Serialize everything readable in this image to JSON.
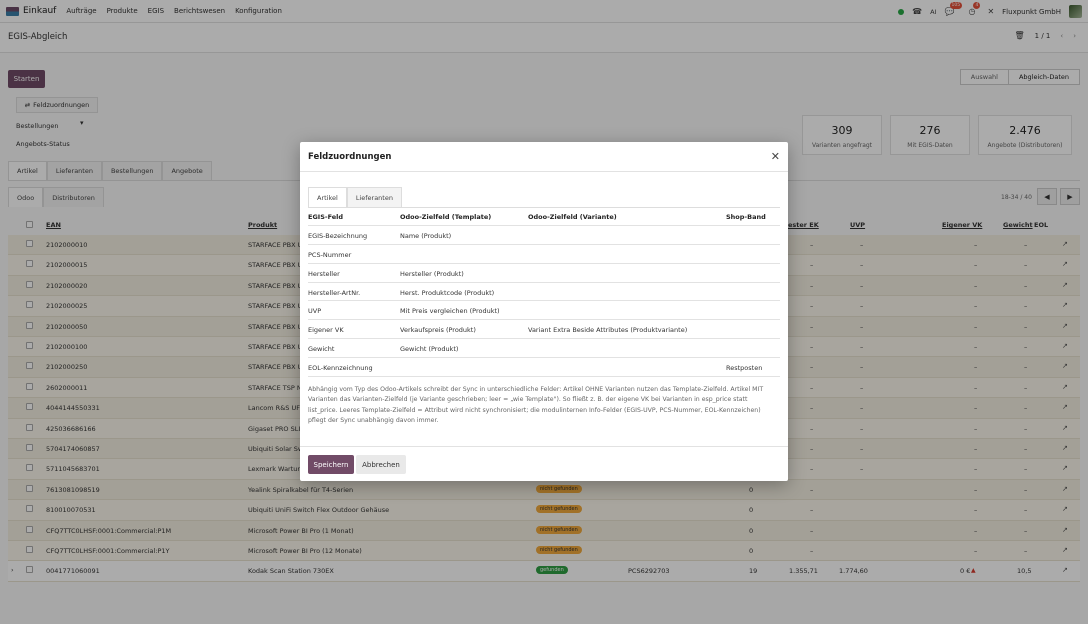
{
  "navbar": {
    "app_name": "Einkauf",
    "menu": [
      "Aufträge",
      "Produkte",
      "EGIS",
      "Berichtswesen",
      "Konfiguration"
    ],
    "badges": {
      "messages": "105",
      "activities": "4"
    },
    "company": "Fluxpunkt GmbH"
  },
  "control": {
    "title": "EGIS-Abgleich",
    "pager": "1 / 1"
  },
  "page": {
    "start_label": "Starten",
    "status_steps": [
      "Auswahl",
      "Abgleich-Daten"
    ],
    "field_mapping_label": "Feldzuordnungen",
    "filters": [
      "Bestellungen",
      "Angebots-Status"
    ],
    "stats": [
      {
        "value": "309",
        "label": "Varianten angefragt"
      },
      {
        "value": "276",
        "label": "Mit EGIS-Daten"
      },
      {
        "value": "2.476",
        "label": "Angebote (Distributoren)"
      }
    ],
    "tabs": [
      "Artikel",
      "Lieferanten",
      "Bestellungen",
      "Angebote"
    ],
    "subtabs": [
      "Odoo",
      "Distributoren"
    ],
    "range": "18-34 / 40"
  },
  "table": {
    "headers": {
      "ean": "EAN",
      "produkt": "Produkt",
      "bester_ek": "ester EK",
      "uvp": "UVP",
      "eigener_vk": "Eigener VK",
      "gewicht": "Gewicht",
      "eol": "EOL"
    },
    "rows": [
      {
        "ean": "2102000010",
        "produkt": "STARFACE PBX U"
      },
      {
        "ean": "2102000015",
        "produkt": "STARFACE PBX U"
      },
      {
        "ean": "2102000020",
        "produkt": "STARFACE PBX U"
      },
      {
        "ean": "2102000025",
        "produkt": "STARFACE PBX U"
      },
      {
        "ean": "2102000050",
        "produkt": "STARFACE PBX U"
      },
      {
        "ean": "2102000100",
        "produkt": "STARFACE PBX U"
      },
      {
        "ean": "2102000250",
        "produkt": "STARFACE PBX U"
      },
      {
        "ean": "2602000011",
        "produkt": "STARFACE TSP N"
      },
      {
        "ean": "4044144550331",
        "produkt": "Lancom R&S UF-"
      },
      {
        "ean": "425036686166",
        "produkt": "Gigaset PRO SLIM"
      },
      {
        "ean": "5704174060857",
        "produkt": "Ubiquiti Solar Sw"
      },
      {
        "ean": "5711045683701",
        "produkt": "Lexmark Wartung"
      },
      {
        "ean": "7613081098519",
        "produkt": "Yealink Spiralkabel für T4-Serien",
        "status": "nicht gefunden",
        "qty": "0"
      },
      {
        "ean": "810010070531",
        "produkt": "Ubiquiti UniFi Switch Flex Outdoor Gehäuse",
        "status": "nicht gefunden",
        "qty": "0"
      },
      {
        "ean": "CFQ7TTC0LHSF:0001:Commercial:P1M",
        "produkt": "Microsoft Power BI Pro (1 Monat)",
        "status": "nicht gefunden",
        "qty": "0"
      },
      {
        "ean": "CFQ7TTC0LHSF:0001:Commercial:P1Y",
        "produkt": "Microsoft Power BI Pro (12 Monate)",
        "status": "nicht gefunden",
        "qty": "0"
      },
      {
        "ean": "0041771060091",
        "produkt": "Kodak Scan Station 730EX",
        "status": "gefunden",
        "pcs": "PCS6292703",
        "qty": "19",
        "ek": "1.355,71",
        "uvp": "1.774,60",
        "vk": "0 €",
        "gewicht": "10,5"
      }
    ],
    "dash": "–"
  },
  "modal": {
    "title": "Feldzuordnungen",
    "tabs": [
      "Artikel",
      "Lieferanten"
    ],
    "columns": [
      "EGIS-Feld",
      "Odoo-Zielfeld (Template)",
      "Odoo-Zielfeld (Variante)",
      "Shop-Band"
    ],
    "rows": [
      {
        "egis": "EGIS-Bezeichnung",
        "template": "Name (Produkt)",
        "variant": "",
        "shop": ""
      },
      {
        "egis": "PCS-Nummer",
        "template": "",
        "variant": "",
        "shop": ""
      },
      {
        "egis": "Hersteller",
        "template": "Hersteller (Produkt)",
        "variant": "",
        "shop": ""
      },
      {
        "egis": "Hersteller-ArtNr.",
        "template": "Herst. Produktcode (Produkt)",
        "variant": "",
        "shop": ""
      },
      {
        "egis": "UVP",
        "template": "Mit Preis vergleichen (Produkt)",
        "variant": "",
        "shop": ""
      },
      {
        "egis": "Eigener VK",
        "template": "Verkaufspreis (Produkt)",
        "variant": "Variant Extra Beside Attributes (Produktvariante)",
        "shop": ""
      },
      {
        "egis": "Gewicht",
        "template": "Gewicht (Produkt)",
        "variant": "",
        "shop": ""
      },
      {
        "egis": "EOL-Kennzeichnung",
        "template": "",
        "variant": "",
        "shop": "Restposten"
      }
    ],
    "note": "Abhängig vom Typ des Odoo-Artikels schreibt der Sync in unterschiedliche Felder: Artikel OHNE Varianten nutzen das Template-Zielfeld. Artikel MIT Varianten das Varianten-Zielfeld (je Variante geschrieben; leer = „wie Template\"). So fließt z. B. der eigene VK bei Varianten in esp_price statt list_price. Leeres Template-Zielfeld = Attribut wird nicht synchronisiert; die modulinternen Info-Felder (EGIS-UVP, PCS-Nummer, EOL-Kennzeichen) pflegt der Sync unabhängig davon immer.",
    "save_label": "Speichern",
    "cancel_label": "Abbrechen"
  },
  "colors": {
    "primary": "#714b67",
    "found": "#2f9e44",
    "not_found": "#f1a93c"
  }
}
